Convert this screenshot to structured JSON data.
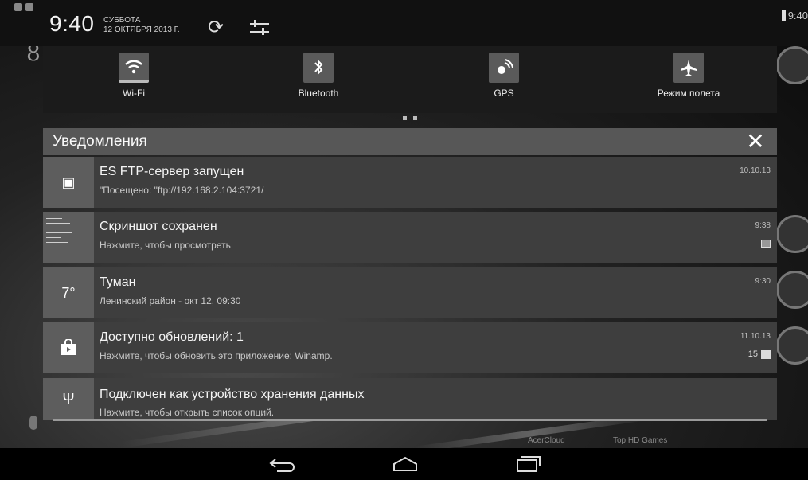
{
  "status_bar": {
    "time": "9:40",
    "day": "СУББОТА",
    "date": "12 ОКТЯБРЯ 2013 Г.",
    "right_time": "9:40"
  },
  "quick_settings": [
    {
      "label": "Wi-Fi",
      "icon": "wifi-icon",
      "active": true
    },
    {
      "label": "Bluetooth",
      "icon": "bluetooth-icon",
      "active": false
    },
    {
      "label": "GPS",
      "icon": "gps-icon",
      "active": false
    },
    {
      "label": "Режим полета",
      "icon": "airplane-icon",
      "active": false
    }
  ],
  "notifications_header": {
    "title": "Уведомления",
    "clear_glyph": "✕"
  },
  "notifications": [
    {
      "title": "ES FTP-сервер запущен",
      "subtitle": "\"Посещено: \"ftp://192.168.2.104:3721/",
      "time": "10.10.13",
      "extra": "",
      "icon": "ftp-server-icon",
      "icon_glyph": "▣"
    },
    {
      "title": "Скриншот сохранен",
      "subtitle": "Нажмите, чтобы просмотреть",
      "time": "9:38",
      "extra": "",
      "icon": "screenshot-thumbnail",
      "icon_glyph": ""
    },
    {
      "title": " Туман",
      "subtitle": "Ленинский район - окт 12, 09:30",
      "time": "9:30",
      "extra": "",
      "icon": "weather-icon",
      "icon_glyph": "7°"
    },
    {
      "title": "Доступно обновлений: 1",
      "subtitle": "Нажмите, чтобы обновить это приложение: Winamp.",
      "time": "11.10.13",
      "extra": "15",
      "icon": "shopping-bag-icon",
      "icon_glyph": "🛍"
    },
    {
      "title": "Подключен как устройство хранения данных",
      "subtitle": "Нажмите, чтобы открыть список опций.",
      "time": "",
      "extra": "",
      "icon": "usb-icon",
      "icon_glyph": "Ψ"
    }
  ],
  "bottom_labels": {
    "left": "AcerCloud",
    "right": "Top HD Games"
  },
  "nav_bar": {
    "back_glyph": "↩",
    "home_glyph": "⌂",
    "recents_glyph": "▭"
  }
}
